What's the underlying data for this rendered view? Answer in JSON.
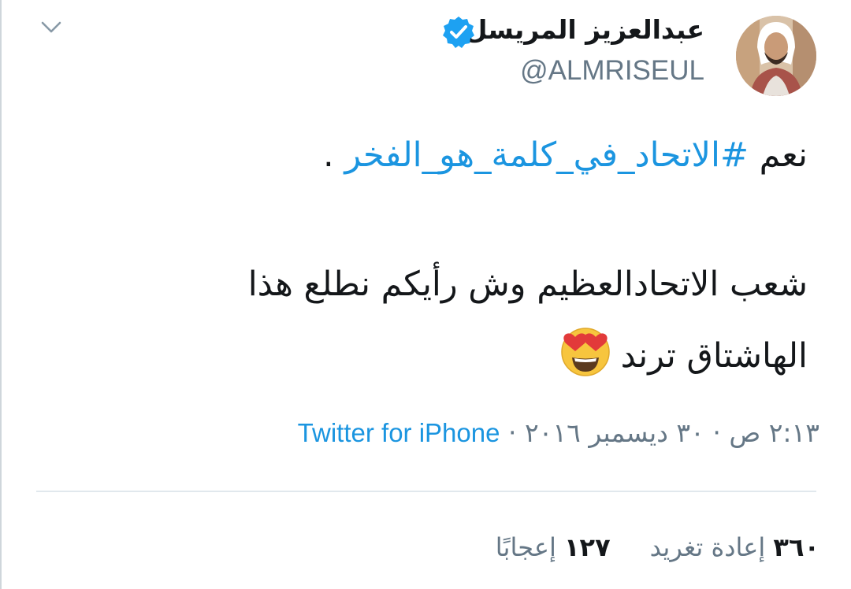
{
  "tweet": {
    "author": {
      "name": "عبدالعزيز المريسل",
      "handle": "@ALMRISEUL",
      "verified": true
    },
    "text": {
      "line1_prefix": "نعم ",
      "hashtag": "#الاتحاد_في_كلمة_هو_الفخر",
      "line1_suffix": " .",
      "line2": "شعب الاتحادالعظيم وش رأيكم نطلع هذا",
      "line3": "الهاشتاق ترند"
    },
    "emoji": "heart-eyes-emoji",
    "timestamp": "٢:١٣ ص · ٣٠ ديسمبر ٢٠١٦",
    "separator": " · ",
    "source": "Twitter for iPhone",
    "stats": {
      "retweets_count": "٣٦٠",
      "retweets_label": "إعادة تغريد",
      "likes_count": "١٢٧",
      "likes_label": "إعجابًا"
    }
  },
  "colors": {
    "link": "#1b95e0",
    "secondary_text": "#657786",
    "primary_text": "#14171a",
    "verified_badge": "#1da1f2",
    "divider": "#e1e8ed"
  },
  "icons": {
    "menu": "chevron-down-icon",
    "verified": "verified-badge-icon"
  }
}
